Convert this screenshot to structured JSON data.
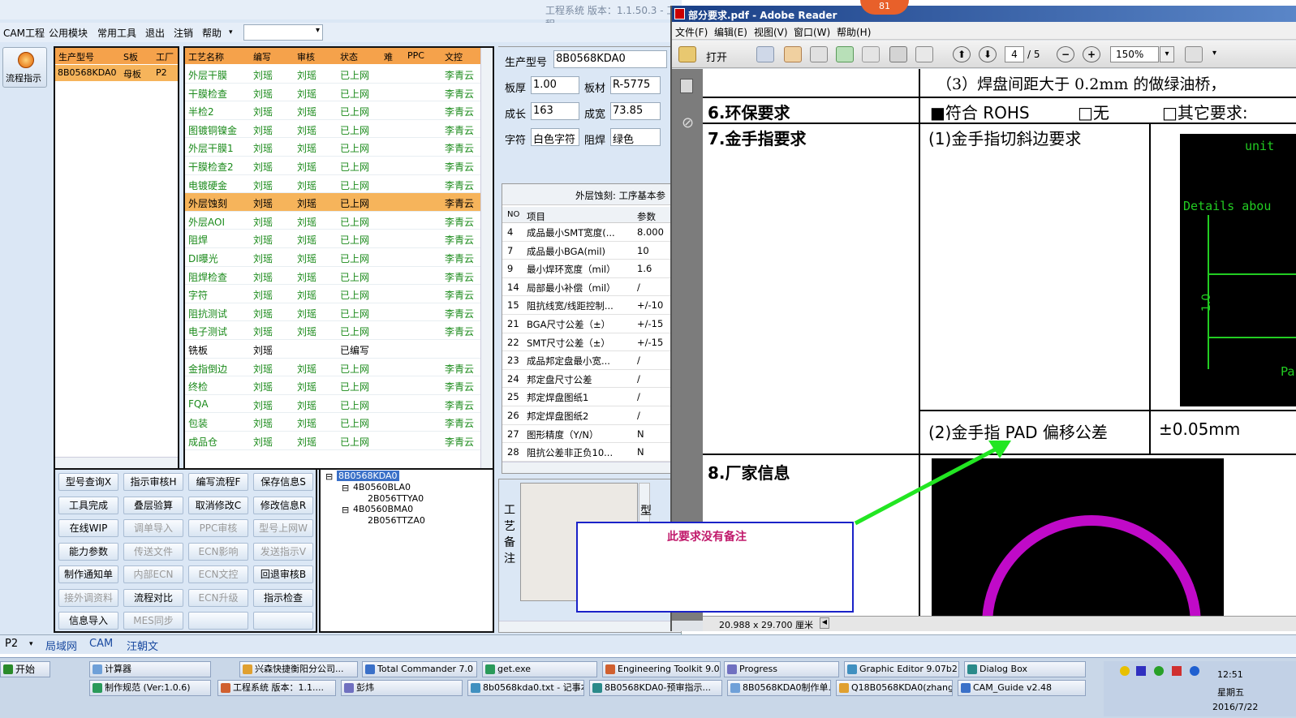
{
  "app": {
    "title": "工程系统   版本：1.1.50.3   - 工程",
    "menu": [
      "CAM工程",
      "公用模块",
      "常用工具",
      "退出",
      "注销",
      "帮助"
    ],
    "flow_button": "流程指示",
    "model_headers": [
      "生产型号",
      "S板",
      "工厂"
    ],
    "model_row": [
      "8B0568KDA0",
      "母板",
      "P2"
    ],
    "process_headers": [
      "工艺名称",
      "编写",
      "审核",
      "状态",
      "难",
      "PPC",
      "文控"
    ],
    "process_rows": [
      [
        "外层干膜",
        "刘瑶",
        "刘瑶",
        "已上网",
        "",
        "",
        "李青云"
      ],
      [
        "干膜检查",
        "刘瑶",
        "刘瑶",
        "已上网",
        "",
        "",
        "李青云"
      ],
      [
        "半检2",
        "刘瑶",
        "刘瑶",
        "已上网",
        "",
        "",
        "李青云"
      ],
      [
        "图镀铜镍金",
        "刘瑶",
        "刘瑶",
        "已上网",
        "",
        "",
        "李青云"
      ],
      [
        "外层干膜1",
        "刘瑶",
        "刘瑶",
        "已上网",
        "",
        "",
        "李青云"
      ],
      [
        "干膜检查2",
        "刘瑶",
        "刘瑶",
        "已上网",
        "",
        "",
        "李青云"
      ],
      [
        "电镀硬金",
        "刘瑶",
        "刘瑶",
        "已上网",
        "",
        "",
        "李青云"
      ],
      [
        "外层蚀刻",
        "刘瑶",
        "刘瑶",
        "已上网",
        "",
        "",
        "李青云"
      ],
      [
        "外层AOI",
        "刘瑶",
        "刘瑶",
        "已上网",
        "",
        "",
        "李青云"
      ],
      [
        "阻焊",
        "刘瑶",
        "刘瑶",
        "已上网",
        "",
        "",
        "李青云"
      ],
      [
        "DI曝光",
        "刘瑶",
        "刘瑶",
        "已上网",
        "",
        "",
        "李青云"
      ],
      [
        "阻焊检查",
        "刘瑶",
        "刘瑶",
        "已上网",
        "",
        "",
        "李青云"
      ],
      [
        "字符",
        "刘瑶",
        "刘瑶",
        "已上网",
        "",
        "",
        "李青云"
      ],
      [
        "阻抗测试",
        "刘瑶",
        "刘瑶",
        "已上网",
        "",
        "",
        "李青云"
      ],
      [
        "电子测试",
        "刘瑶",
        "刘瑶",
        "已上网",
        "",
        "",
        "李青云"
      ],
      [
        "铣板",
        "刘瑶",
        "",
        "已编写",
        "",
        "",
        ""
      ],
      [
        "金指倒边",
        "刘瑶",
        "刘瑶",
        "已上网",
        "",
        "",
        "李青云"
      ],
      [
        "终检",
        "刘瑶",
        "刘瑶",
        "已上网",
        "",
        "",
        "李青云"
      ],
      [
        "FQA",
        "刘瑶",
        "刘瑶",
        "已上网",
        "",
        "",
        "李青云"
      ],
      [
        "包装",
        "刘瑶",
        "刘瑶",
        "已上网",
        "",
        "",
        "李青云"
      ],
      [
        "成品仓",
        "刘瑶",
        "刘瑶",
        "已上网",
        "",
        "",
        "李青云"
      ]
    ],
    "buttons": [
      [
        "型号查询X",
        "指示审核H",
        "编写流程F",
        "保存信息S"
      ],
      [
        "工具完成",
        "叠层验算",
        "取消修改C",
        "修改信息R"
      ],
      [
        "在线WIP",
        "调单导入",
        "PPC审核",
        "型号上网W"
      ],
      [
        "能力参数",
        "传送文件",
        "ECN影响",
        "发送指示V"
      ],
      [
        "制作通知单",
        "内部ECN",
        "ECN文控",
        "回退审核B"
      ],
      [
        "接外调资料",
        "流程对比",
        "ECN升级",
        "指示检查"
      ],
      [
        "信息导入",
        "MES同步",
        "",
        ""
      ]
    ],
    "tree": [
      "8B0568KDA0",
      "4B0560BLA0",
      "2B056TTYA0",
      "4B0560BMA0",
      "2B056TTZA0"
    ],
    "info": {
      "model_label": "生产型号",
      "model": "8B0568KDA0",
      "thick_label": "板厚",
      "thick": "1.00",
      "mat_label": "板材",
      "mat": "R-5775",
      "len_label": "成长",
      "len": "163",
      "wid_label": "成宽",
      "wid": "73.85",
      "char_label": "字符",
      "char": "白色字符",
      "mask_label": "阻焊",
      "mask": "绿色"
    },
    "params_title": "外层蚀刻: 工序基本参",
    "params_headers": [
      "NO",
      "项目",
      "参数"
    ],
    "params_rows": [
      [
        "4",
        "成品最小SMT宽度(...",
        "8.000"
      ],
      [
        "7",
        "成品最小BGA(mil)",
        "10"
      ],
      [
        "9",
        "最小焊环宽度（mil）",
        "1.6"
      ],
      [
        "14",
        "局部最小补偿（mil）",
        "/"
      ],
      [
        "15",
        "阻抗线宽/线距控制...",
        "+/-10"
      ],
      [
        "21",
        "BGA尺寸公差（±）",
        "+/-15"
      ],
      [
        "22",
        "SMT尺寸公差（±）",
        "+/-15"
      ],
      [
        "23",
        "成品邦定盘最小宽...",
        "/"
      ],
      [
        "24",
        "邦定盘尺寸公差",
        "/"
      ],
      [
        "25",
        "邦定焊盘图纸1",
        "/"
      ],
      [
        "26",
        "邦定焊盘图纸2",
        "/"
      ],
      [
        "27",
        "图形精度（Y/N）",
        "N"
      ],
      [
        "28",
        "阻抗公差非正负10...",
        "N"
      ]
    ],
    "remark_label": "工艺备注",
    "remark_side": "型",
    "status": [
      "P2",
      "局域网",
      "CAM",
      "汪朝文"
    ]
  },
  "adobe": {
    "badge": "81",
    "title": "部分要求.pdf - Adobe Reader",
    "menu": [
      "文件(F)",
      "编辑(E)",
      "视图(V)",
      "窗口(W)",
      "帮助(H)"
    ],
    "open": "打开",
    "page": "4",
    "pages": "/ 5",
    "zoom": "150%",
    "doc": {
      "row3": "（3）焊盘间距大于 0.2mm 的做绿油桥，",
      "env": "6.环保要求",
      "rohs": "■符合 ROHS",
      "none": "□无",
      "other": "□其它要求:",
      "gold": "7.金手指要求",
      "gold1": "(1)金手指切斜边要求",
      "gold2": "(2)金手指 PAD 偏移公差",
      "tol": "±0.05mm",
      "vendor": "8.厂家信息",
      "cad1": "unit",
      "cad2": "Details abou",
      "cad3": "1.0",
      "cad4": "Pa"
    },
    "note": "此要求没有备注",
    "size": "20.988 x 29.700 厘米"
  },
  "taskbar": {
    "start": "开始",
    "row1": [
      "计算器",
      "兴森快捷衡阳分公司...",
      "Total Commander 7.0 ...",
      "get.exe",
      "Engineering Toolkit 9.0...",
      "Progress",
      "Graphic Editor 9.07b2 (...",
      "Dialog Box"
    ],
    "row2": [
      "制作规范 (Ver:1.0.6)",
      "工程系统  版本：1.1....",
      "彭炜",
      "8b0568kda0.txt - 记事本",
      "8B0568KDA0-预审指示...",
      "8B0568KDA0制作单.xls...",
      "Q18B0568KDA0(zhang...",
      "CAM_Guide v2.48"
    ],
    "time": "12:51",
    "weekday": "星期五",
    "date": "2016/7/22"
  },
  "colors": {
    "header": "#f5a24b",
    "selected": "#f6b45b",
    "green_text": "#1a8a1a",
    "note_text": "#c0186a",
    "arrow": "#22e622"
  }
}
